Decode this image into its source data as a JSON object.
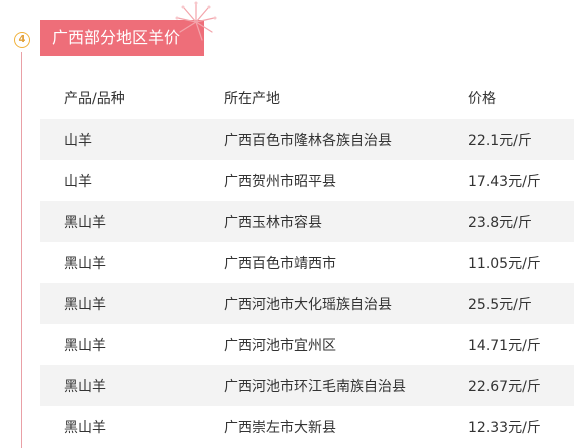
{
  "section": {
    "number": "4",
    "title": "广西部分地区羊价"
  },
  "table": {
    "headers": [
      "产品/品种",
      "所在产地",
      "价格"
    ],
    "rows": [
      [
        "山羊",
        "广西百色市隆林各族自治县",
        "22.1元/斤"
      ],
      [
        "山羊",
        "广西贺州市昭平县",
        "17.43元/斤"
      ],
      [
        "黑山羊",
        "广西玉林市容县",
        "23.8元/斤"
      ],
      [
        "黑山羊",
        "广西百色市靖西市",
        "11.05元/斤"
      ],
      [
        "黑山羊",
        "广西河池市大化瑶族自治县",
        "25.5元/斤"
      ],
      [
        "黑山羊",
        "广西河池市宜州区",
        "14.71元/斤"
      ],
      [
        "黑山羊",
        "广西河池市环江毛南族自治县",
        "22.67元/斤"
      ],
      [
        "黑山羊",
        "广西崇左市大新县",
        "12.33元/斤"
      ]
    ]
  },
  "colors": {
    "accent": "#ee6e79",
    "badge": "#f1b23c",
    "row_shade": "#f3f3f3"
  }
}
